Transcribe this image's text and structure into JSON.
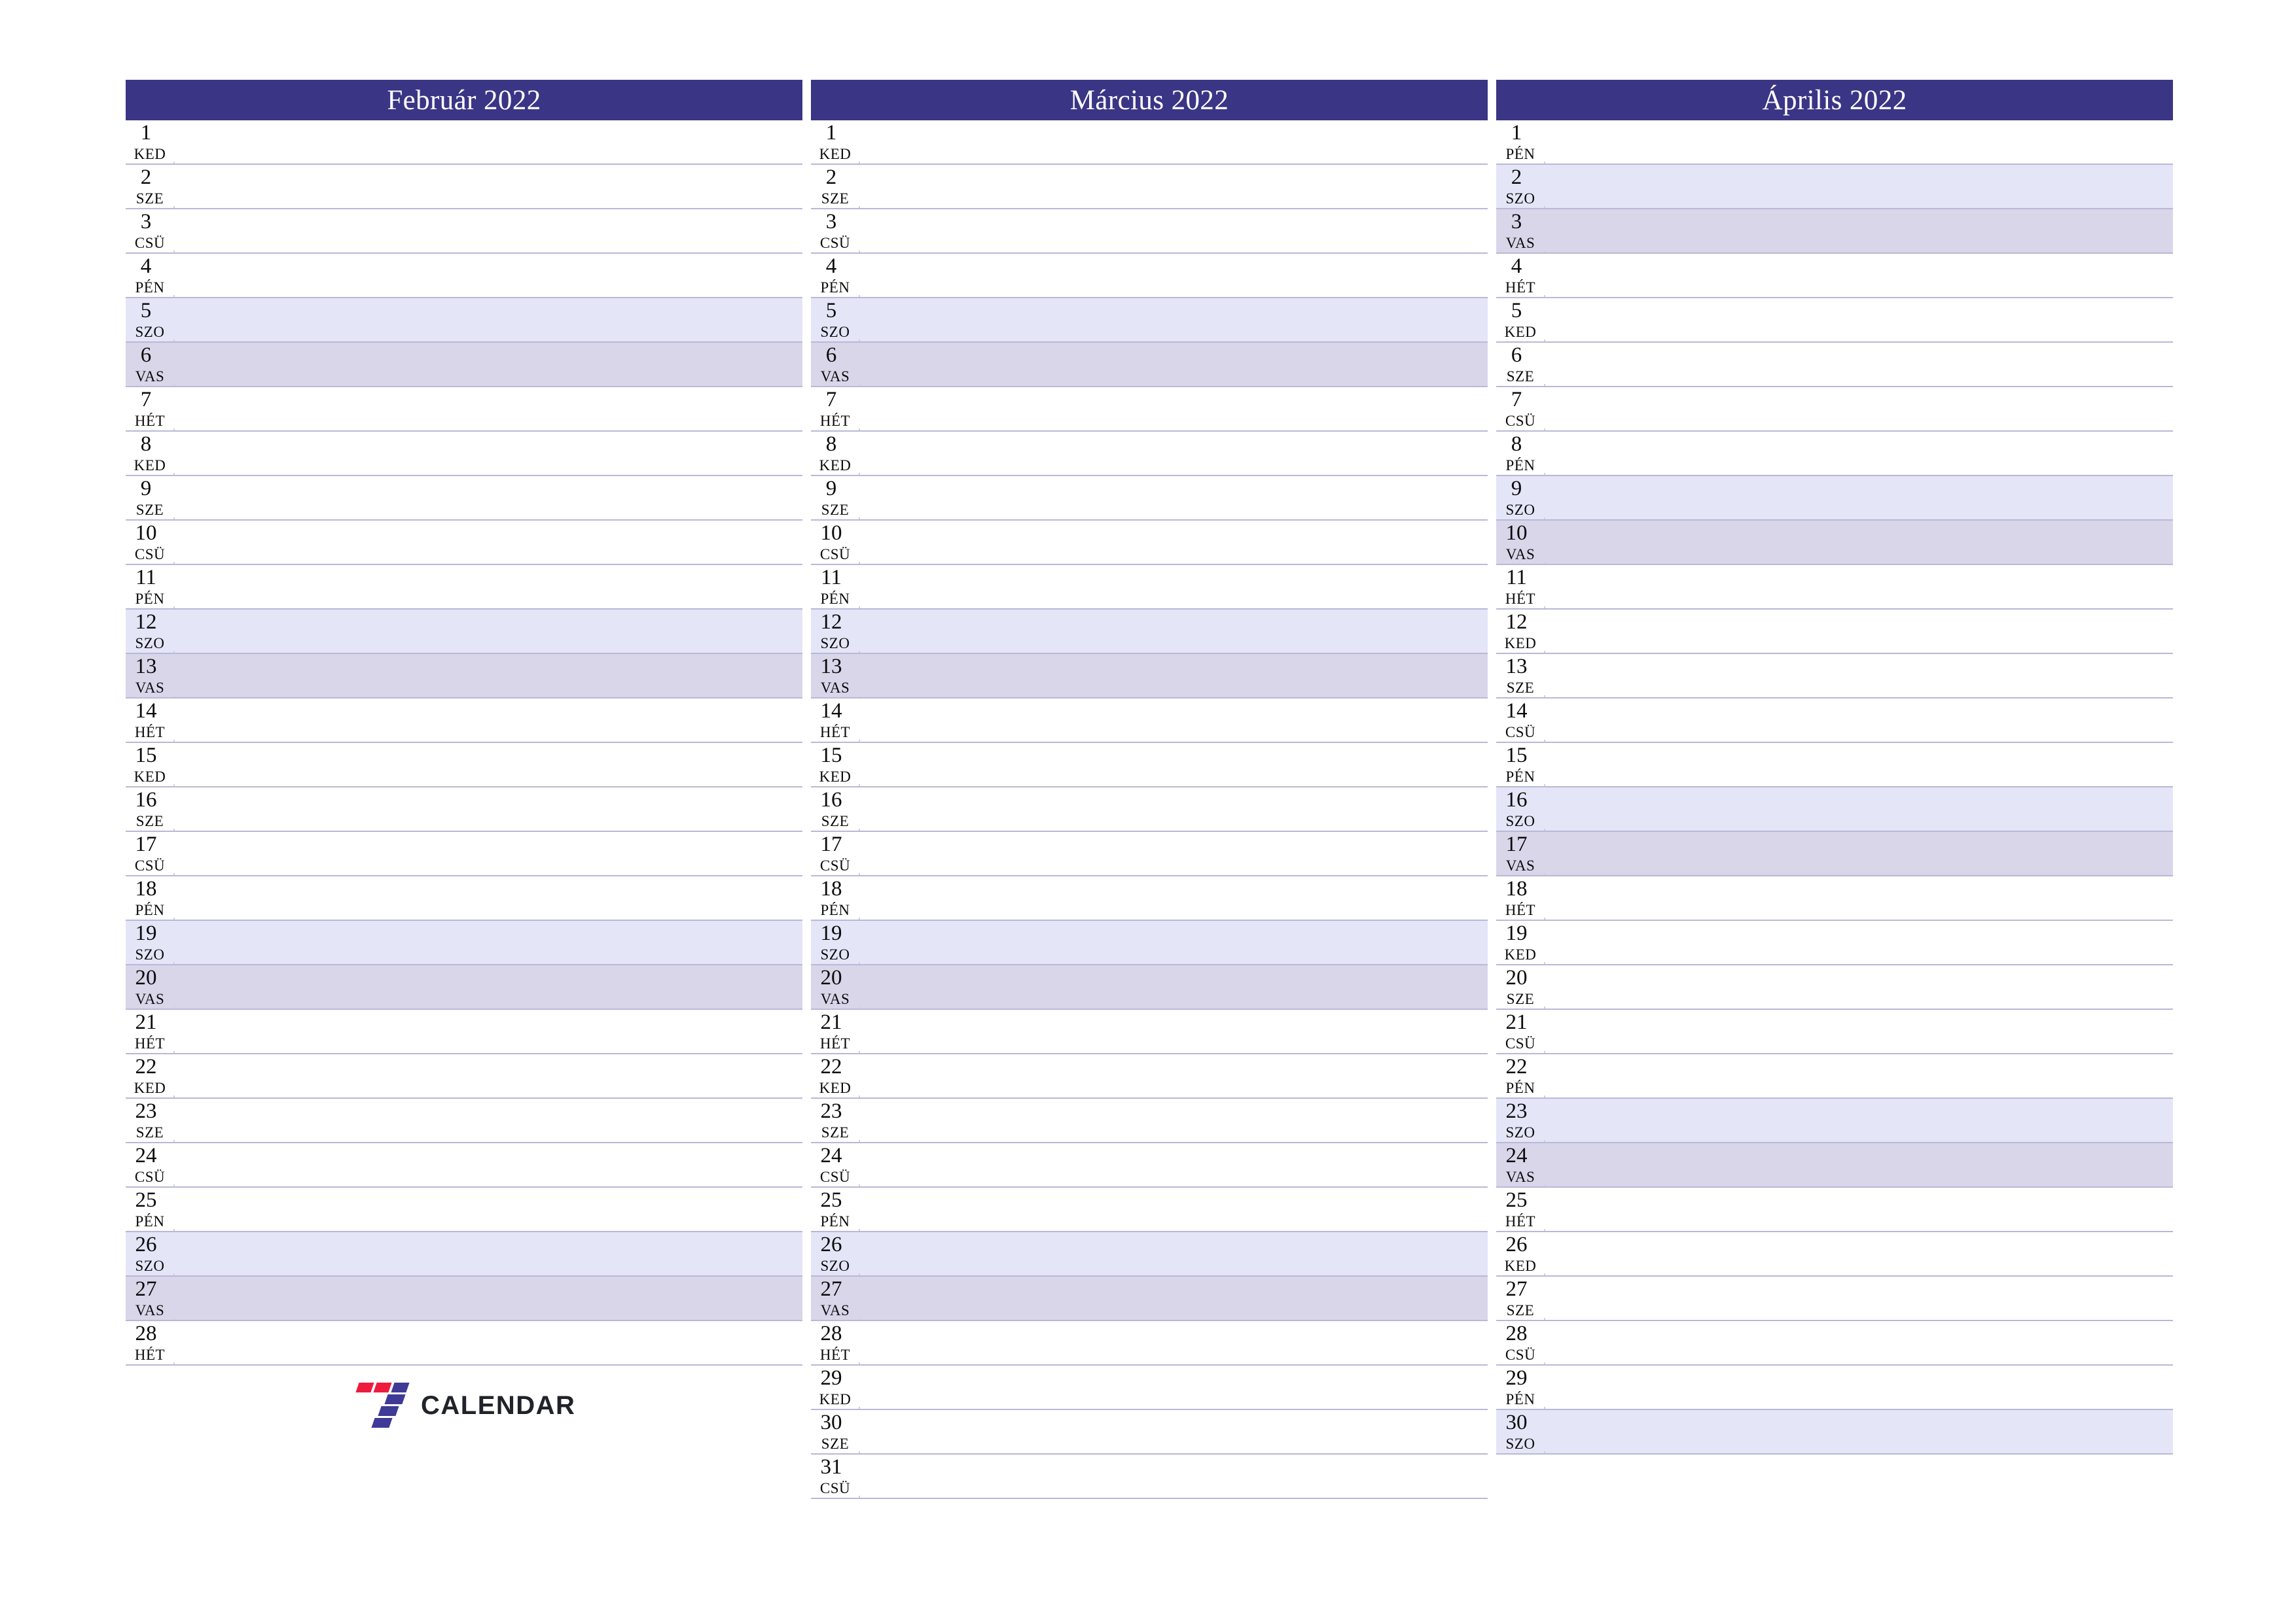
{
  "document": {
    "type": "monthly-planner",
    "year": "2022",
    "language": "hu"
  },
  "colors": {
    "header_background": "#3b3585",
    "header_text": "#ffffff",
    "row_separator": "#b9b8d8",
    "saturday_background": "#e4e5f7",
    "sunday_background": "#d9d6ea",
    "page_background": "#ffffff",
    "logo_red": "#ee1b3f",
    "logo_indigo": "#3f3a96",
    "logo_text": "#20232a"
  },
  "logo": {
    "name": "7-calendar-logo",
    "wordmark": "CALENDAR",
    "mark": "7"
  },
  "months": [
    {
      "id": "februar",
      "title": "Február 2022",
      "days": [
        {
          "num": "1",
          "name": "KED",
          "type": "weekday"
        },
        {
          "num": "2",
          "name": "SZE",
          "type": "weekday"
        },
        {
          "num": "3",
          "name": "CSÜ",
          "type": "weekday"
        },
        {
          "num": "4",
          "name": "PÉN",
          "type": "weekday"
        },
        {
          "num": "5",
          "name": "SZO",
          "type": "sat"
        },
        {
          "num": "6",
          "name": "VAS",
          "type": "sun"
        },
        {
          "num": "7",
          "name": "HÉT",
          "type": "weekday"
        },
        {
          "num": "8",
          "name": "KED",
          "type": "weekday"
        },
        {
          "num": "9",
          "name": "SZE",
          "type": "weekday"
        },
        {
          "num": "10",
          "name": "CSÜ",
          "type": "weekday"
        },
        {
          "num": "11",
          "name": "PÉN",
          "type": "weekday"
        },
        {
          "num": "12",
          "name": "SZO",
          "type": "sat"
        },
        {
          "num": "13",
          "name": "VAS",
          "type": "sun"
        },
        {
          "num": "14",
          "name": "HÉT",
          "type": "weekday"
        },
        {
          "num": "15",
          "name": "KED",
          "type": "weekday"
        },
        {
          "num": "16",
          "name": "SZE",
          "type": "weekday"
        },
        {
          "num": "17",
          "name": "CSÜ",
          "type": "weekday"
        },
        {
          "num": "18",
          "name": "PÉN",
          "type": "weekday"
        },
        {
          "num": "19",
          "name": "SZO",
          "type": "sat"
        },
        {
          "num": "20",
          "name": "VAS",
          "type": "sun"
        },
        {
          "num": "21",
          "name": "HÉT",
          "type": "weekday"
        },
        {
          "num": "22",
          "name": "KED",
          "type": "weekday"
        },
        {
          "num": "23",
          "name": "SZE",
          "type": "weekday"
        },
        {
          "num": "24",
          "name": "CSÜ",
          "type": "weekday"
        },
        {
          "num": "25",
          "name": "PÉN",
          "type": "weekday"
        },
        {
          "num": "26",
          "name": "SZO",
          "type": "sat"
        },
        {
          "num": "27",
          "name": "VAS",
          "type": "sun"
        },
        {
          "num": "28",
          "name": "HÉT",
          "type": "weekday"
        }
      ]
    },
    {
      "id": "marcius",
      "title": "Március 2022",
      "days": [
        {
          "num": "1",
          "name": "KED",
          "type": "weekday"
        },
        {
          "num": "2",
          "name": "SZE",
          "type": "weekday"
        },
        {
          "num": "3",
          "name": "CSÜ",
          "type": "weekday"
        },
        {
          "num": "4",
          "name": "PÉN",
          "type": "weekday"
        },
        {
          "num": "5",
          "name": "SZO",
          "type": "sat"
        },
        {
          "num": "6",
          "name": "VAS",
          "type": "sun"
        },
        {
          "num": "7",
          "name": "HÉT",
          "type": "weekday"
        },
        {
          "num": "8",
          "name": "KED",
          "type": "weekday"
        },
        {
          "num": "9",
          "name": "SZE",
          "type": "weekday"
        },
        {
          "num": "10",
          "name": "CSÜ",
          "type": "weekday"
        },
        {
          "num": "11",
          "name": "PÉN",
          "type": "weekday"
        },
        {
          "num": "12",
          "name": "SZO",
          "type": "sat"
        },
        {
          "num": "13",
          "name": "VAS",
          "type": "sun"
        },
        {
          "num": "14",
          "name": "HÉT",
          "type": "weekday"
        },
        {
          "num": "15",
          "name": "KED",
          "type": "weekday"
        },
        {
          "num": "16",
          "name": "SZE",
          "type": "weekday"
        },
        {
          "num": "17",
          "name": "CSÜ",
          "type": "weekday"
        },
        {
          "num": "18",
          "name": "PÉN",
          "type": "weekday"
        },
        {
          "num": "19",
          "name": "SZO",
          "type": "sat"
        },
        {
          "num": "20",
          "name": "VAS",
          "type": "sun"
        },
        {
          "num": "21",
          "name": "HÉT",
          "type": "weekday"
        },
        {
          "num": "22",
          "name": "KED",
          "type": "weekday"
        },
        {
          "num": "23",
          "name": "SZE",
          "type": "weekday"
        },
        {
          "num": "24",
          "name": "CSÜ",
          "type": "weekday"
        },
        {
          "num": "25",
          "name": "PÉN",
          "type": "weekday"
        },
        {
          "num": "26",
          "name": "SZO",
          "type": "sat"
        },
        {
          "num": "27",
          "name": "VAS",
          "type": "sun"
        },
        {
          "num": "28",
          "name": "HÉT",
          "type": "weekday"
        },
        {
          "num": "29",
          "name": "KED",
          "type": "weekday"
        },
        {
          "num": "30",
          "name": "SZE",
          "type": "weekday"
        },
        {
          "num": "31",
          "name": "CSÜ",
          "type": "weekday"
        }
      ]
    },
    {
      "id": "aprilis",
      "title": "Április 2022",
      "days": [
        {
          "num": "1",
          "name": "PÉN",
          "type": "weekday"
        },
        {
          "num": "2",
          "name": "SZO",
          "type": "sat"
        },
        {
          "num": "3",
          "name": "VAS",
          "type": "sun"
        },
        {
          "num": "4",
          "name": "HÉT",
          "type": "weekday"
        },
        {
          "num": "5",
          "name": "KED",
          "type": "weekday"
        },
        {
          "num": "6",
          "name": "SZE",
          "type": "weekday"
        },
        {
          "num": "7",
          "name": "CSÜ",
          "type": "weekday"
        },
        {
          "num": "8",
          "name": "PÉN",
          "type": "weekday"
        },
        {
          "num": "9",
          "name": "SZO",
          "type": "sat"
        },
        {
          "num": "10",
          "name": "VAS",
          "type": "sun"
        },
        {
          "num": "11",
          "name": "HÉT",
          "type": "weekday"
        },
        {
          "num": "12",
          "name": "KED",
          "type": "weekday"
        },
        {
          "num": "13",
          "name": "SZE",
          "type": "weekday"
        },
        {
          "num": "14",
          "name": "CSÜ",
          "type": "weekday"
        },
        {
          "num": "15",
          "name": "PÉN",
          "type": "weekday"
        },
        {
          "num": "16",
          "name": "SZO",
          "type": "sat"
        },
        {
          "num": "17",
          "name": "VAS",
          "type": "sun"
        },
        {
          "num": "18",
          "name": "HÉT",
          "type": "weekday"
        },
        {
          "num": "19",
          "name": "KED",
          "type": "weekday"
        },
        {
          "num": "20",
          "name": "SZE",
          "type": "weekday"
        },
        {
          "num": "21",
          "name": "CSÜ",
          "type": "weekday"
        },
        {
          "num": "22",
          "name": "PÉN",
          "type": "weekday"
        },
        {
          "num": "23",
          "name": "SZO",
          "type": "sat"
        },
        {
          "num": "24",
          "name": "VAS",
          "type": "sun"
        },
        {
          "num": "25",
          "name": "HÉT",
          "type": "weekday"
        },
        {
          "num": "26",
          "name": "KED",
          "type": "weekday"
        },
        {
          "num": "27",
          "name": "SZE",
          "type": "weekday"
        },
        {
          "num": "28",
          "name": "CSÜ",
          "type": "weekday"
        },
        {
          "num": "29",
          "name": "PÉN",
          "type": "weekday"
        },
        {
          "num": "30",
          "name": "SZO",
          "type": "sat"
        }
      ]
    }
  ]
}
